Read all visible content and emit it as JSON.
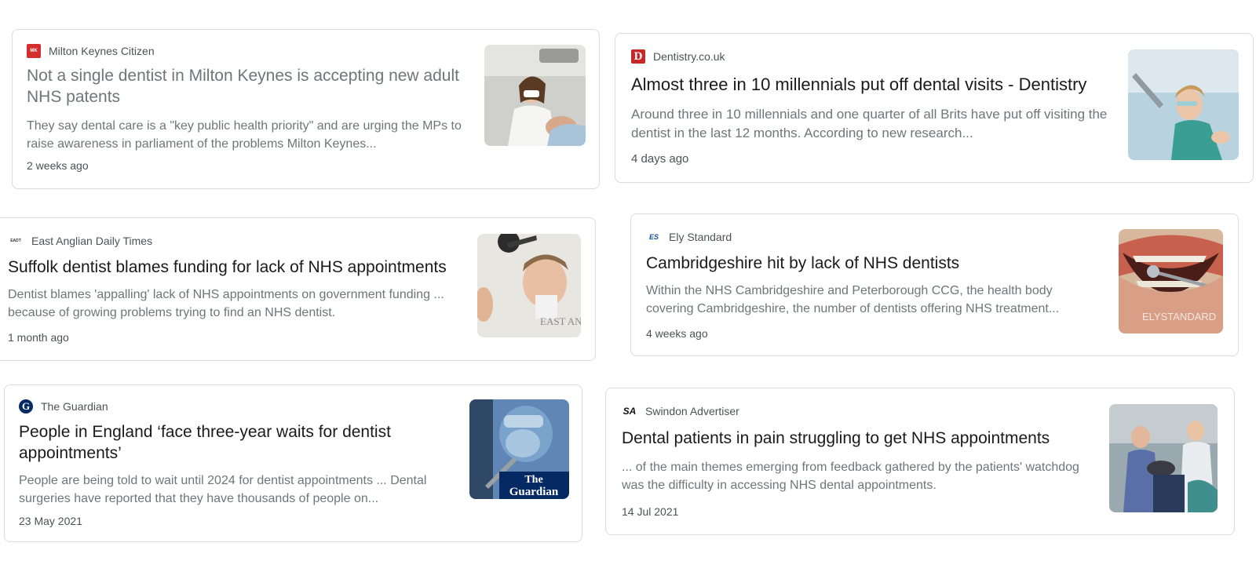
{
  "cards": [
    {
      "source": "Milton Keynes Citizen",
      "icon": "milton-keynes-citizen-logo",
      "title": "Not a single dentist in Milton Keynes is accepting new adult NHS patents",
      "snippet": "They say dental care is a \"key public health priority\" and are urging the MPs to raise awareness in parliament of the problems Milton Keynes...",
      "date": "2 weeks ago",
      "image": "dentist-treating-patient-photo"
    },
    {
      "source": "Dentistry.co.uk",
      "icon": "dentistry-logo",
      "icon_text": "D",
      "title": "Almost three in 10 millennials put off dental visits - Dentistry",
      "snippet": "Around three in 10 millennials and one quarter of all Brits have put off visiting the dentist in the last 12 months. According to new research...",
      "date": "4 days ago",
      "image": "dental-nurse-photo"
    },
    {
      "source": "East Anglian Daily Times",
      "icon": "east-anglian-daily-times-logo",
      "icon_text": "EADT",
      "title": "Suffolk dentist blames funding for lack of NHS appointments",
      "snippet": "Dentist blames 'appalling' lack of NHS appointments on government funding ... because of growing problems trying to find an NHS dentist.",
      "date": "1 month ago",
      "image": "dentist-with-lamp-photo",
      "image_watermark": "EAST AN"
    },
    {
      "source": "Ely Standard",
      "icon": "ely-standard-logo",
      "icon_text": "ES",
      "title": "Cambridgeshire hit by lack of NHS dentists",
      "snippet": "Within the NHS Cambridgeshire and Peterborough CCG, the health body covering Cambridgeshire, the number of dentists offering NHS treatment...",
      "date": "4 weeks ago",
      "image": "open-mouth-dental-mirror-photo",
      "image_watermark": "ELYSTANDARD"
    },
    {
      "source": "The Guardian",
      "icon": "guardian-logo",
      "icon_text": "G",
      "title": "People in England ‘face three-year waits for dentist appointments’",
      "snippet": "People are being told to wait until 2024 for dentist appointments ... Dental surgeries have reported that they have thousands of people on...",
      "date": "23 May 2021",
      "image": "masked-dentist-photo",
      "image_watermark": "The Guardian"
    },
    {
      "source": "Swindon Advertiser",
      "icon": "swindon-advertiser-logo",
      "icon_text": "SA",
      "title": "Dental patients in pain struggling to get NHS appointments",
      "snippet": "... of the main themes emerging from feedback gathered by the patients' watchdog was the difficulty in accessing NHS dental appointments.",
      "date": "14 Jul 2021",
      "image": "dental-surgery-photo"
    }
  ],
  "colors": {
    "title": "#1a1a1a",
    "visited_title": "#70757a",
    "snippet": "#70757a",
    "meta": "#4d5156",
    "border": "#dadce0"
  }
}
